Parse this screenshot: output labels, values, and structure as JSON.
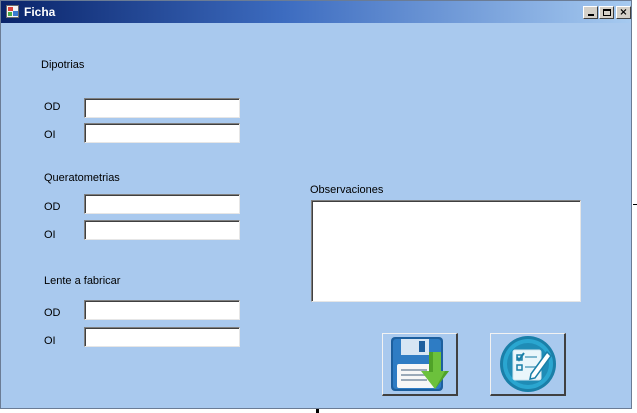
{
  "window": {
    "title": "Ficha",
    "minimize_label": "_",
    "maximize_label": "□",
    "close_label": "×"
  },
  "sections": {
    "dipotrias": {
      "heading": "Dipotrias",
      "od_label": "OD",
      "oi_label": "OI",
      "od_value": "",
      "oi_value": ""
    },
    "queratometrias": {
      "heading": "Queratometrias",
      "od_label": "OD",
      "oi_label": "OI",
      "od_value": "",
      "oi_value": ""
    },
    "lente": {
      "heading": "Lente a fabricar",
      "od_label": "OD",
      "oi_label": "OI",
      "od_value": "",
      "oi_value": ""
    }
  },
  "observaciones": {
    "label": "Observaciones",
    "value": ""
  },
  "buttons": {
    "save_icon": "floppy-disk-download-icon",
    "edit_icon": "edit-form-icon"
  },
  "colors": {
    "form_background": "#a9c9ee",
    "titlebar_start": "#0a246a",
    "titlebar_end": "#a6caf0"
  }
}
